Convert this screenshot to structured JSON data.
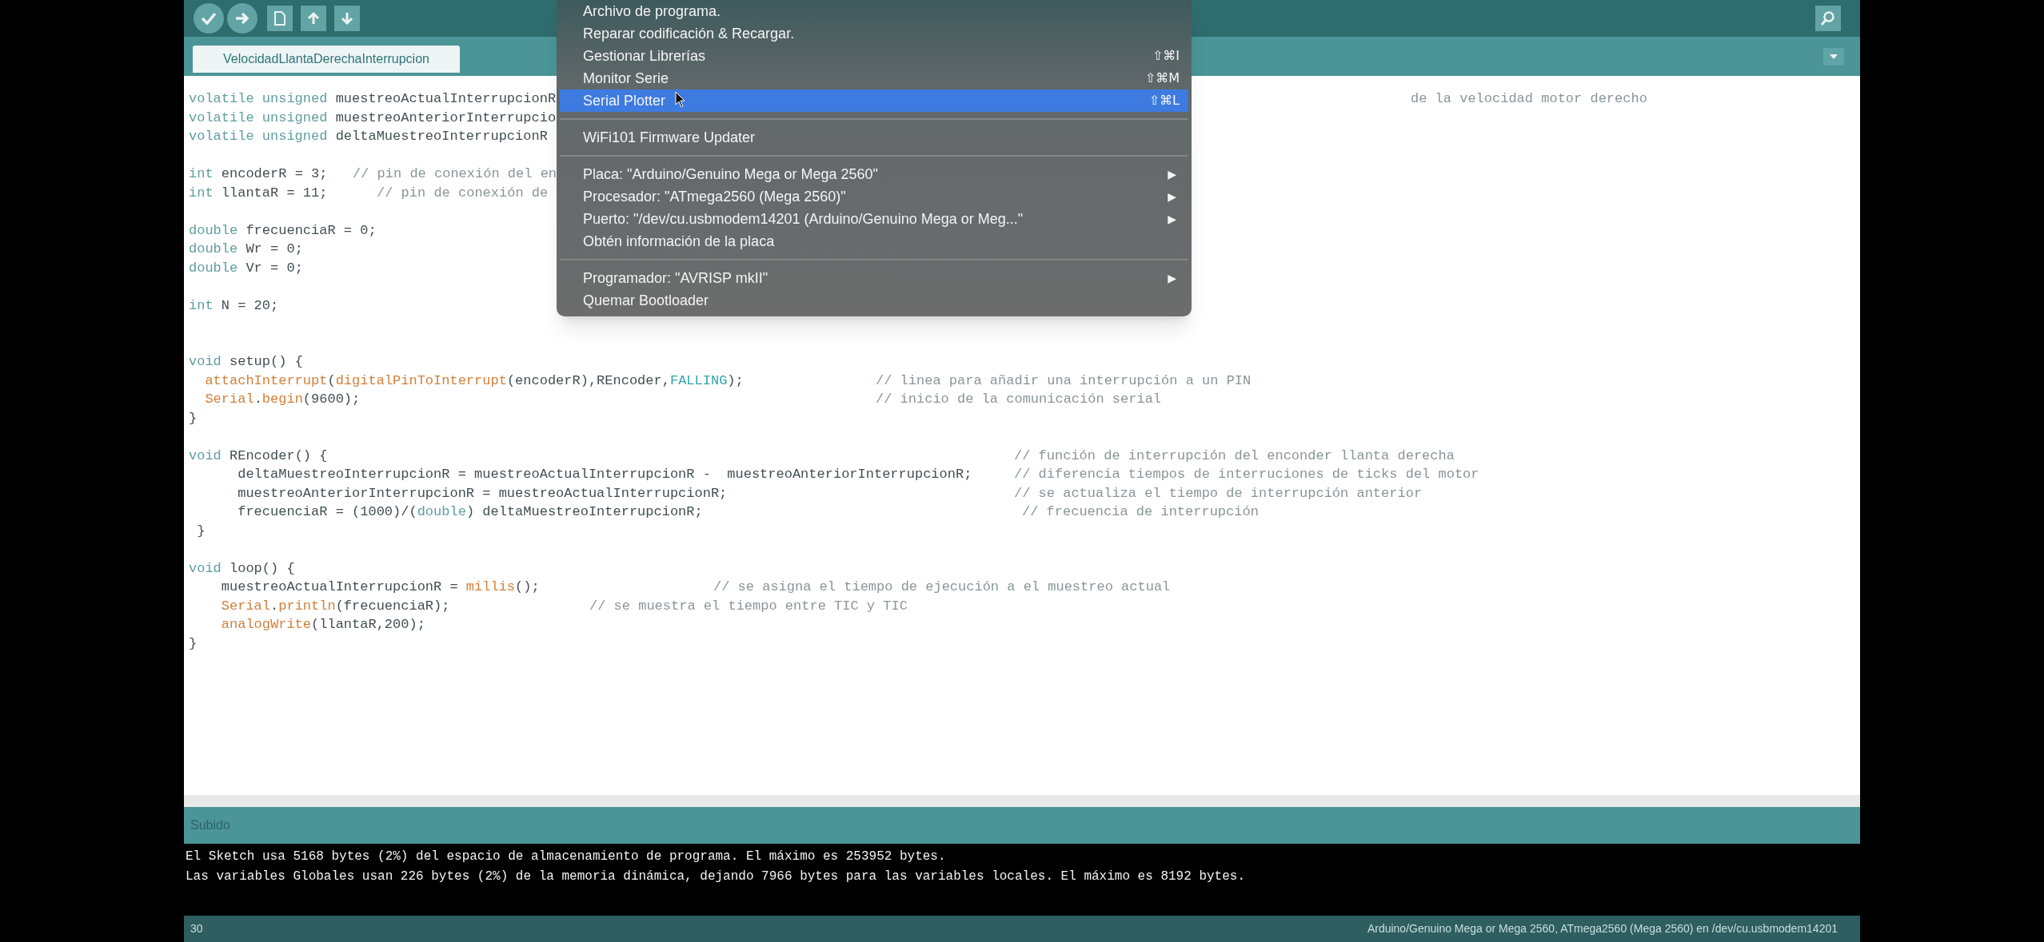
{
  "tabs": [
    {
      "label": "VelocidadLlantaDerechaInterrupcion",
      "selected": true
    }
  ],
  "editor": {
    "lines": [
      {
        "kind": "code",
        "segments": [
          {
            "kind": "keyword",
            "text": "volatile unsigned"
          },
          {
            "kind": "plain",
            "text": " muestreoActualInterrupcionR"
          }
        ],
        "comment": "de la velocidad motor derecho"
      },
      {
        "kind": "code",
        "segments": [
          {
            "kind": "keyword",
            "text": "volatile unsigned"
          },
          {
            "kind": "plain",
            "text": " muestreoAnteriorInterrupcio"
          }
        ]
      },
      {
        "kind": "code",
        "segments": [
          {
            "kind": "keyword",
            "text": "volatile unsigned"
          },
          {
            "kind": "plain",
            "text": " deltaMuestreoInterrupcionR"
          }
        ]
      },
      {
        "kind": "blank"
      },
      {
        "kind": "code",
        "segments": [
          {
            "kind": "keyword",
            "text": "int"
          },
          {
            "kind": "plain",
            "text": " encoderR = 3;"
          }
        ],
        "comment": "// pin de conexión del en"
      },
      {
        "kind": "code",
        "segments": [
          {
            "kind": "keyword",
            "text": "int"
          },
          {
            "kind": "plain",
            "text": " llantaR = 11;"
          }
        ],
        "comment": "// pin de conexión de"
      },
      {
        "kind": "blank"
      },
      {
        "kind": "code",
        "segments": [
          {
            "kind": "keyword",
            "text": "double"
          },
          {
            "kind": "plain",
            "text": " frecuenciaR = 0;"
          }
        ]
      },
      {
        "kind": "code",
        "segments": [
          {
            "kind": "keyword",
            "text": "double"
          },
          {
            "kind": "plain",
            "text": " Wr = 0;"
          }
        ]
      },
      {
        "kind": "code",
        "segments": [
          {
            "kind": "keyword",
            "text": "double"
          },
          {
            "kind": "plain",
            "text": " Vr = 0;"
          }
        ]
      },
      {
        "kind": "blank"
      },
      {
        "kind": "code",
        "segments": [
          {
            "kind": "keyword",
            "text": "int"
          },
          {
            "kind": "plain",
            "text": " N = 20;"
          }
        ]
      },
      {
        "kind": "blank"
      },
      {
        "kind": "blank"
      },
      {
        "kind": "code",
        "segments": [
          {
            "kind": "keyword",
            "text": "void"
          },
          {
            "kind": "plain",
            "text": " setup() {"
          }
        ]
      },
      {
        "kind": "code",
        "segments": [
          {
            "kind": "function",
            "text": "  attachInterrupt"
          },
          {
            "kind": "plain",
            "text": "("
          },
          {
            "kind": "function",
            "text": "digitalPinToInterrupt"
          },
          {
            "kind": "plain",
            "text": "(encoderR),REncoder,"
          },
          {
            "kind": "constant",
            "text": "FALLING"
          },
          {
            "kind": "plain",
            "text": ");"
          }
        ],
        "comment": "// linea para añadir una interrupción a un PIN"
      },
      {
        "kind": "code",
        "segments": [
          {
            "kind": "function",
            "text": "  Serial"
          },
          {
            "kind": "plain",
            "text": "."
          },
          {
            "kind": "function",
            "text": "begin"
          },
          {
            "kind": "plain",
            "text": "(9600);"
          }
        ],
        "comment": "// inicio de la comunicación serial"
      },
      {
        "kind": "code",
        "segments": [
          {
            "kind": "plain",
            "text": "}"
          }
        ]
      },
      {
        "kind": "blank"
      },
      {
        "kind": "code",
        "segments": [
          {
            "kind": "keyword",
            "text": "void"
          },
          {
            "kind": "plain",
            "text": " REncoder() {"
          }
        ],
        "comment": "// función de interrupción del enconder llanta derecha"
      },
      {
        "kind": "code",
        "segments": [
          {
            "kind": "plain",
            "text": "      deltaMuestreoInterrupcionR = muestreoActualInterrupcionR -  muestreoAnteriorInterrupcionR;"
          }
        ],
        "comment": "// diferencia tiempos de interruciones de ticks del motor"
      },
      {
        "kind": "code",
        "segments": [
          {
            "kind": "plain",
            "text": "      muestreoAnteriorInterrupcionR = muestreoActualInterrupcionR;"
          }
        ],
        "comment": "// se actualiza el tiempo de interrupción anterior"
      },
      {
        "kind": "code",
        "segments": [
          {
            "kind": "plain",
            "text": "      frecuenciaR = (1000)/("
          },
          {
            "kind": "keyword",
            "text": "double"
          },
          {
            "kind": "plain",
            "text": ") deltaMuestreoInterrupcionR;"
          }
        ],
        "comment": "// frecuencia de interrupción"
      },
      {
        "kind": "code",
        "segments": [
          {
            "kind": "plain",
            "text": " }"
          }
        ]
      },
      {
        "kind": "blank"
      },
      {
        "kind": "code",
        "segments": [
          {
            "kind": "keyword",
            "text": "void"
          },
          {
            "kind": "plain",
            "text": " loop() {"
          }
        ]
      },
      {
        "kind": "code",
        "segments": [
          {
            "kind": "plain",
            "text": "    muestreoActualInterrupcionR = "
          },
          {
            "kind": "function",
            "text": "millis"
          },
          {
            "kind": "plain",
            "text": "();"
          }
        ],
        "comment": "// se asigna el tiempo de ejecución a el muestreo actual"
      },
      {
        "kind": "code",
        "segments": [
          {
            "kind": "function",
            "text": "    Serial"
          },
          {
            "kind": "plain",
            "text": "."
          },
          {
            "kind": "function",
            "text": "println"
          },
          {
            "kind": "plain",
            "text": "(frecuenciaR);"
          }
        ],
        "comment": "// se muestra el tiempo entre TIC y TIC"
      },
      {
        "kind": "code",
        "segments": [
          {
            "kind": "function",
            "text": "    analogWrite"
          },
          {
            "kind": "plain",
            "text": "(llantaR,200);"
          }
        ]
      },
      {
        "kind": "code",
        "segments": [
          {
            "kind": "plain",
            "text": "}"
          }
        ]
      }
    ]
  },
  "menu": {
    "items": [
      {
        "kind": "item",
        "label": "Archivo de programa.",
        "selected": false
      },
      {
        "kind": "item",
        "label": "Reparar codificación & Recargar.",
        "selected": false
      },
      {
        "kind": "item",
        "label": "Gestionar Librerías",
        "shortcut": "⇧⌘I",
        "selected": false
      },
      {
        "kind": "item",
        "label": "Monitor Serie",
        "shortcut": "⇧⌘M",
        "selected": false
      },
      {
        "kind": "item",
        "label": "Serial Plotter",
        "shortcut": "⇧⌘L",
        "selected": true
      },
      {
        "kind": "separator"
      },
      {
        "kind": "item",
        "label": "WiFi101 Firmware Updater",
        "selected": false
      },
      {
        "kind": "separator"
      },
      {
        "kind": "item",
        "label": "Placa: \"Arduino/Genuino Mega or Mega 2560\"",
        "arrow": "▶",
        "selected": false
      },
      {
        "kind": "item",
        "label": "Procesador: \"ATmega2560 (Mega 2560)\"",
        "arrow": "▶",
        "selected": false
      },
      {
        "kind": "item",
        "label": "Puerto: \"/dev/cu.usbmodem14201 (Arduino/Genuino Mega or Meg...\"",
        "arrow": "▶",
        "selected": false
      },
      {
        "kind": "item",
        "label": "Obtén información de la placa",
        "selected": false
      },
      {
        "kind": "separator"
      },
      {
        "kind": "item",
        "label": "Programador: \"AVRISP mkII\"",
        "arrow": "▶",
        "selected": false
      },
      {
        "kind": "item",
        "label": "Quemar Bootloader",
        "selected": false
      }
    ]
  },
  "console": {
    "header": "Subido",
    "lines": [
      "El Sketch usa 5168 bytes (2%) del espacio de almacenamiento de programa. El máximo es 253952 bytes.",
      "Las variables Globales usan 226 bytes (2%) de la memoria dinámica, dejando 7966 bytes para las variables locales. El máximo es 8192 bytes."
    ]
  },
  "status_bar": {
    "line": "30",
    "board": "Arduino/Genuino Mega or Mega 2560, ATmega2560 (Mega 2560) en /dev/cu.usbmodem14201"
  }
}
